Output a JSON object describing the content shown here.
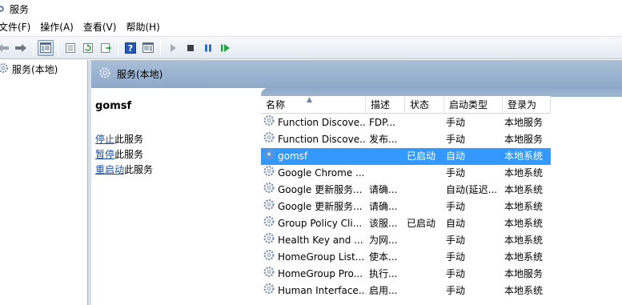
{
  "window": {
    "title": "服务"
  },
  "menu": [
    {
      "label": "文件(F)"
    },
    {
      "label": "操作(A)"
    },
    {
      "label": "查看(V)"
    },
    {
      "label": "帮助(H)"
    }
  ],
  "toolbar": {
    "buttons": [
      "back-arrow-icon",
      "forward-arrow-icon",
      "show-hide-console-tree-icon",
      "properties-icon",
      "refresh-icon",
      "export-list-icon",
      "help-icon",
      "show-hide-action-pane-icon",
      "start-service-icon",
      "stop-service-icon",
      "pause-service-icon",
      "restart-service-icon"
    ]
  },
  "tree": {
    "root_label": "服务(本地)"
  },
  "pane": {
    "header_label": "服务(本地)",
    "selected_service": "gomsf",
    "actions": [
      {
        "link": "停止",
        "suffix": "此服务"
      },
      {
        "link": "暂停",
        "suffix": "此服务"
      },
      {
        "link": "重启动",
        "suffix": "此服务"
      }
    ]
  },
  "list": {
    "columns": [
      "名称",
      "描述",
      "状态",
      "启动类型",
      "登录为"
    ],
    "rows": [
      {
        "name": "Function Discove...",
        "desc": "FDP...",
        "status": "",
        "startup": "手动",
        "logon": "本地服务",
        "selected": false
      },
      {
        "name": "Function Discove...",
        "desc": "发布...",
        "status": "",
        "startup": "手动",
        "logon": "本地服务",
        "selected": false
      },
      {
        "name": "gomsf",
        "desc": "",
        "status": "已启动",
        "startup": "自动",
        "logon": "本地系统",
        "selected": true
      },
      {
        "name": "Google Chrome ...",
        "desc": "",
        "status": "",
        "startup": "手动",
        "logon": "本地系统",
        "selected": false
      },
      {
        "name": "Google 更新服务...",
        "desc": "请确...",
        "status": "",
        "startup": "自动(延迟...",
        "logon": "本地系统",
        "selected": false
      },
      {
        "name": "Google 更新服务...",
        "desc": "请确...",
        "status": "",
        "startup": "手动",
        "logon": "本地系统",
        "selected": false
      },
      {
        "name": "Group Policy Cli...",
        "desc": "该服...",
        "status": "已启动",
        "startup": "自动",
        "logon": "本地系统",
        "selected": false
      },
      {
        "name": "Health Key and ...",
        "desc": "为网...",
        "status": "",
        "startup": "手动",
        "logon": "本地系统",
        "selected": false
      },
      {
        "name": "HomeGroup List...",
        "desc": "使本...",
        "status": "",
        "startup": "手动",
        "logon": "本地系统",
        "selected": false
      },
      {
        "name": "HomeGroup Pro...",
        "desc": "执行...",
        "status": "",
        "startup": "手动",
        "logon": "本地服务",
        "selected": false
      },
      {
        "name": "Human Interface...",
        "desc": "启用...",
        "status": "",
        "startup": "手动",
        "logon": "本地系统",
        "selected": false
      }
    ]
  }
}
